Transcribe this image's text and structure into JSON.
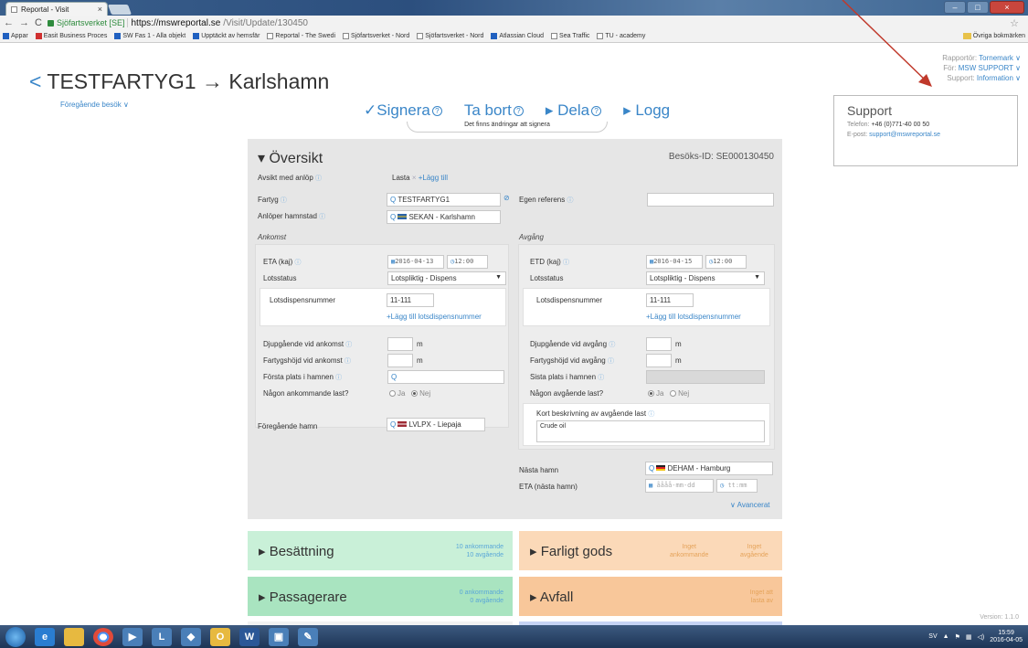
{
  "browser": {
    "tab_title": "Reportal - Visit",
    "secure_label": "Sjöfartsverket [SE]",
    "url_host": "https://mswreportal.se",
    "url_path": "/Visit/Update/130450",
    "bookmarks": [
      "Appar",
      "Easit Business Proces",
      "SW Fas 1 - Alla objekt",
      "Upptäckt av hemsfär",
      "Reportal - The Swedi",
      "Sjöfartsverket - Nord",
      "Sjöfartsverket - Nord",
      "Atlassian Cloud",
      "Sea Traffic",
      "TU - academy"
    ],
    "other_bookmarks": "Övriga bokmärken"
  },
  "header": {
    "back_glyph": "<",
    "title": "TESTFARTYG1 → Karlshamn",
    "prev_visit": "Föregående besök ∨",
    "reporter_label": "Rapportör:",
    "reporter_value": "Tornemark ∨",
    "for_label": "För:",
    "for_value": "MSW SUPPORT ∨",
    "support_label": "Support:",
    "support_value": "Information ∨"
  },
  "support": {
    "title": "Support",
    "phone_label": "Telefon:",
    "phone": "+46 (0)771-40 00 50",
    "email_label": "E-post:",
    "email": "support@mswreportal.se"
  },
  "actions": {
    "sign": "✓Signera",
    "delete": "Ta bort",
    "share": "▸ Dela",
    "log": "▸ Logg",
    "note": "Det finns ändringar att signera"
  },
  "overview": {
    "title": "▾ Översikt",
    "visit_id": "Besöks-ID: SE000130450",
    "purpose_label": "Avsikt med anlöp",
    "purpose_tag": "Lasta",
    "add": "+Lägg till",
    "ship_label": "Fartyg",
    "ship_value": "TESTFARTYG1",
    "own_ref_label": "Egen referens",
    "port_label": "Anlöper hamnstad",
    "port_value": "SEKAN - Karlshamn",
    "arrival_head": "Ankomst",
    "departure_head": "Avgång",
    "eta_label": "ETA (kaj)",
    "eta_date": "2016-04-13",
    "eta_time": "12:00",
    "etd_label": "ETD (kaj)",
    "etd_date": "2016-04-15",
    "etd_time": "12:00",
    "pilot_label": "Lotsstatus",
    "pilot_value": "Lotspliktig - Dispens",
    "exemption_label": "Lotsdispensnummer",
    "exemption_value": "11-111",
    "add_exemption": "+Lägg till lotsdispensnummer",
    "draft_arr_label": "Djupgående vid ankomst",
    "air_arr_label": "Fartygshöjd vid ankomst",
    "draft_dep_label": "Djupgående vid avgång",
    "air_dep_label": "Fartygshöjd vid avgång",
    "unit_m": "m",
    "first_place_label": "Första plats i hamnen",
    "last_place_label": "Sista plats i hamnen",
    "cargo_in_label": "Någon ankommande last?",
    "cargo_out_label": "Någon avgående last?",
    "yes": "Ja",
    "no": "Nej",
    "cargo_desc_label": "Kort beskrivning av avgående last",
    "cargo_desc_value": "Crude oil",
    "prev_port_label": "Föregående hamn",
    "prev_port_value": "LVLPX - Liepaja",
    "next_port_label": "Nästa hamn",
    "next_port_value": "DEHAM - Hamburg",
    "eta_next_label": "ETA (nästa hamn)",
    "date_placeholder": "åååå-mm-dd",
    "time_placeholder": "tt:mm",
    "advanced": "∨ Avancerat"
  },
  "tiles": {
    "crew": "▸ Besättning",
    "crew_count_1": "10 ankommande",
    "crew_count_2": "10 avgående",
    "dg": "▸ Farligt gods",
    "dg_in_1": "Inget",
    "dg_in_2": "ankommande",
    "dg_out_1": "Inget",
    "dg_out_2": "avgående",
    "pax": "▸ Passagerare",
    "pax_count_1": "0 ankommande",
    "pax_count_2": "0 avgående",
    "waste": "▸ Avfall",
    "waste_1": "Inget att",
    "waste_2": "lasta av"
  },
  "footer": {
    "version": "Version: 1.1.0",
    "lang": "SV",
    "time": "15:59",
    "date": "2016-04-05"
  },
  "colors": {
    "accent": "#3a86c8",
    "panel": "#e6e6e6",
    "annotation_arrow": "#c0392b"
  }
}
